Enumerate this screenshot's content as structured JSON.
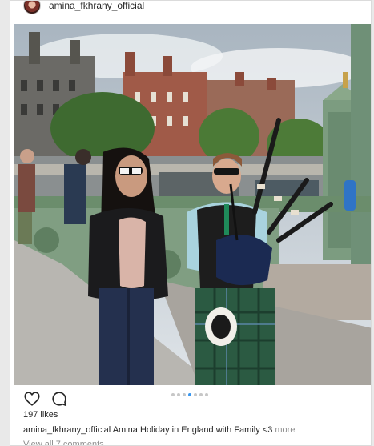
{
  "post": {
    "username": "amina_fkhrany_official",
    "image": {
      "scene": "photo",
      "carousel": {
        "count": 7,
        "active_index": 3
      }
    },
    "likes_text": "197 likes",
    "caption": {
      "username": "amina_fkhrany_official",
      "text": "Amina Holiday in England with Family <3",
      "more_label": "more"
    },
    "view_comments_text": "View all 7 comments"
  },
  "icons": {
    "like": "heart-icon",
    "comment": "comment-bubble-icon"
  },
  "colors": {
    "carousel_active": "#3897f0",
    "carousel_inactive": "#c7c7c7",
    "muted_text": "#8e8e8e",
    "text": "#262626"
  }
}
